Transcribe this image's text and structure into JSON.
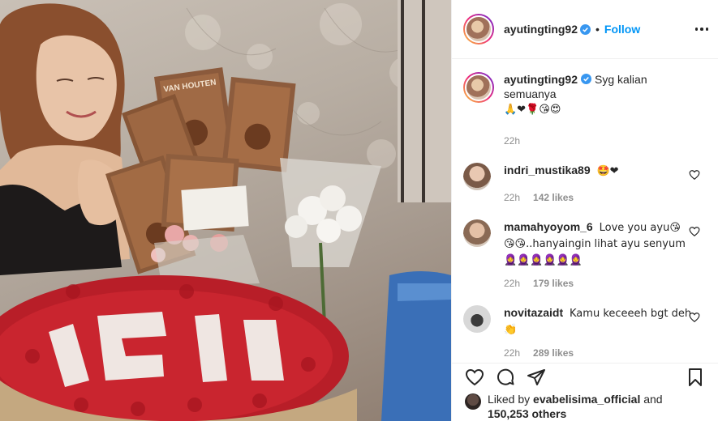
{
  "header": {
    "username": "ayutingting92",
    "separator": "•",
    "follow_label": "Follow",
    "more_icon": "more-options-icon"
  },
  "caption": {
    "username": "ayutingting92",
    "text": "Syg kalian semuanya",
    "emojis": "🙏❤🌹😘😍",
    "time": "22h"
  },
  "comments": [
    {
      "username": "indri_mustika89",
      "text": "🤩❤",
      "time": "22h",
      "likes": "142 likes"
    },
    {
      "username": "mamahyoyom_6",
      "text": "Love you ayu😘 😘😘..hanyaingin lihat ayu senyum 🧕🧕🧕🧕🧕🧕",
      "time": "22h",
      "likes": "179 likes"
    },
    {
      "username": "novitazaidt",
      "text": "Kamu keceeeh bgt deh👏",
      "time": "22h",
      "likes": "289 likes"
    }
  ],
  "liked": {
    "prefix": "Liked by",
    "user": "evabelisima_official",
    "and": "and",
    "count": "150,253 others"
  },
  "photo_text": {
    "box_brand": "VAN HOUTEN"
  },
  "colors": {
    "accent": "#0095f6",
    "text": "#262626",
    "muted": "#8e8e8e",
    "like": "#ed4956"
  }
}
